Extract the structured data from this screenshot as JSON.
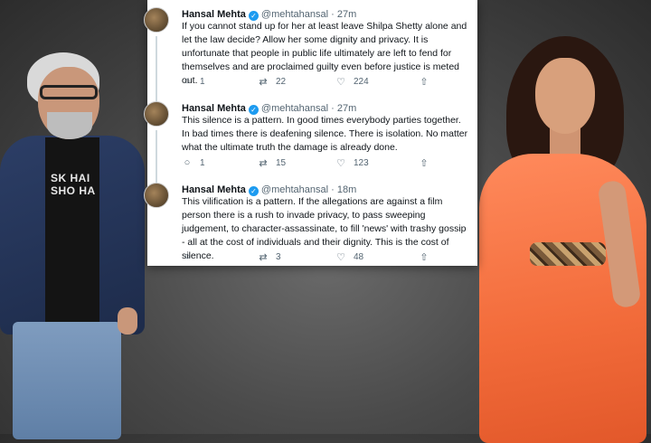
{
  "tweets": [
    {
      "name": "Hansal Mehta",
      "handle": "@mehtahansal",
      "time": "27m",
      "text": "If you cannot stand up for her at least leave Shilpa Shetty alone and let the law decide? Allow her some dignity and privacy. It is unfortunate that people in public life ultimately are left to fend for themselves and are proclaimed guilty even before justice is meted out.",
      "replies": "1",
      "retweets": "22",
      "likes": "224"
    },
    {
      "name": "Hansal Mehta",
      "handle": "@mehtahansal",
      "time": "27m",
      "text": "This silence is a pattern. In good times everybody parties together. In bad times there is deafening silence. There is isolation. No matter what the ultimate truth the damage is  already done.",
      "replies": "1",
      "retweets": "15",
      "likes": "123"
    },
    {
      "name": "Hansal Mehta",
      "handle": "@mehtahansal",
      "time": "18m",
      "text": "This vilification is a pattern. If the allegations are against a film person there is a rush to invade privacy, to pass sweeping judgement, to character-assassinate, to fill 'news' with trashy gossip - all at the cost of individuals and their dignity. This is the cost of silence.",
      "replies": "",
      "retweets": "3",
      "likes": "48"
    }
  ],
  "shirt_text": "SK HAI\nSHO HA",
  "colors": {
    "accent": "#1d9bf0",
    "text": "#0f1419",
    "muted": "#536471",
    "dress": "#f26b3a"
  },
  "icons": {
    "reply": "reply-icon",
    "retweet": "retweet-icon",
    "like": "like-icon",
    "share": "share-icon"
  }
}
